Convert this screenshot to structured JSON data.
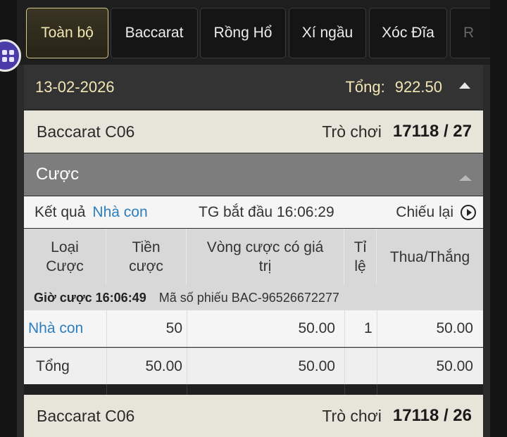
{
  "tabs": [
    "Toàn bộ",
    "Baccarat",
    "Rồng Hổ",
    "Xí ngầu",
    "Xóc Đĩa",
    "R"
  ],
  "day": {
    "date": "13-02-2026",
    "total_label": "Tổng:",
    "total_value": "922.50"
  },
  "games": [
    {
      "name": "Baccarat C06",
      "round_label": "Trò chơi",
      "round": "17118 / 27"
    },
    {
      "name": "Baccarat C06",
      "round_label": "Trò chơi",
      "round": "17118 / 26"
    }
  ],
  "bet_section": {
    "title": "Cược",
    "result_label": "Kết quả",
    "result_value": "Nhà con",
    "start_time": "TG bắt đầu 16:06:29",
    "replay_label": "Chiếu lại"
  },
  "table": {
    "headers": {
      "bet_type_1": "Loại",
      "bet_type_2": "Cược",
      "amount_1": "Tiền",
      "amount_2": "cược",
      "valid_1": "Vòng cược có giá",
      "valid_2": "trị",
      "odds_1": "Tỉ",
      "odds_2": "lệ",
      "winloss": "Thua/Thắng"
    },
    "ticket": {
      "time": "Giờ cược 16:06:49",
      "ticket_no": "Mã số phiếu BAC-96526672277"
    },
    "rows": [
      {
        "type": "Nhà con",
        "amount": "50",
        "valid": "50.00",
        "odds": "1",
        "winloss": "50.00"
      }
    ],
    "total": {
      "label": "Tổng",
      "amount": "50.00",
      "valid": "50.00",
      "winloss": "50.00"
    }
  },
  "colors": {
    "accent_gold": "#f1e6b4",
    "link_blue": "#2c7fbf",
    "float_button": "#4a3ca8"
  },
  "icons": [
    "apps-grid-icon",
    "collapse-up-icon",
    "play-circle-icon"
  ]
}
